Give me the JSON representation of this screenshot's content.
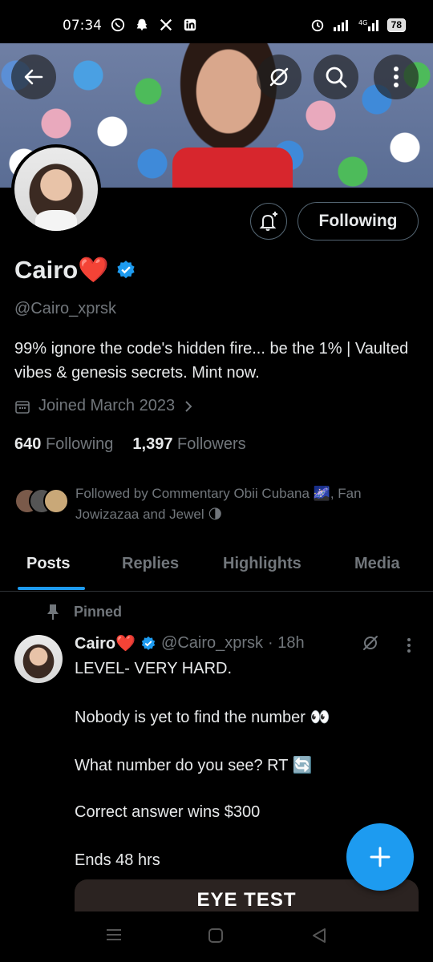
{
  "status_bar": {
    "time": "07:34",
    "battery": "78"
  },
  "profile": {
    "display_name": "Cairo❤️",
    "handle": "@Cairo_xprsk",
    "bio": "99% ignore the code's hidden fire... be the 1% | Vaulted vibes & genesis secrets. Mint now.",
    "joined": "Joined March 2023",
    "following_count": "640",
    "following_label": "Following",
    "followers_count": "1,397",
    "followers_label": "Followers",
    "followed_by": "Followed by Commentary Obii Cubana 🌌, Fan Jowizazaa and Jewel 🌗",
    "follow_button": "Following"
  },
  "tabs": [
    {
      "label": "Posts",
      "active": true
    },
    {
      "label": "Replies",
      "active": false
    },
    {
      "label": "Highlights",
      "active": false
    },
    {
      "label": "Media",
      "active": false
    }
  ],
  "tweet": {
    "pinned_label": "Pinned",
    "name": "Cairo❤️",
    "handle": "@Cairo_xprsk",
    "time": "· 18h",
    "lines": [
      "LEVEL- VERY HARD.",
      "Nobody is yet to find the number 👀",
      "What number do you see?  RT 🔄",
      "Correct answer wins $300",
      "Ends 48 hrs"
    ],
    "media_caption": "EYE TEST"
  },
  "colors": {
    "accent": "#1d9bf0",
    "secondary_text": "#71767b",
    "border": "#2f3336"
  }
}
